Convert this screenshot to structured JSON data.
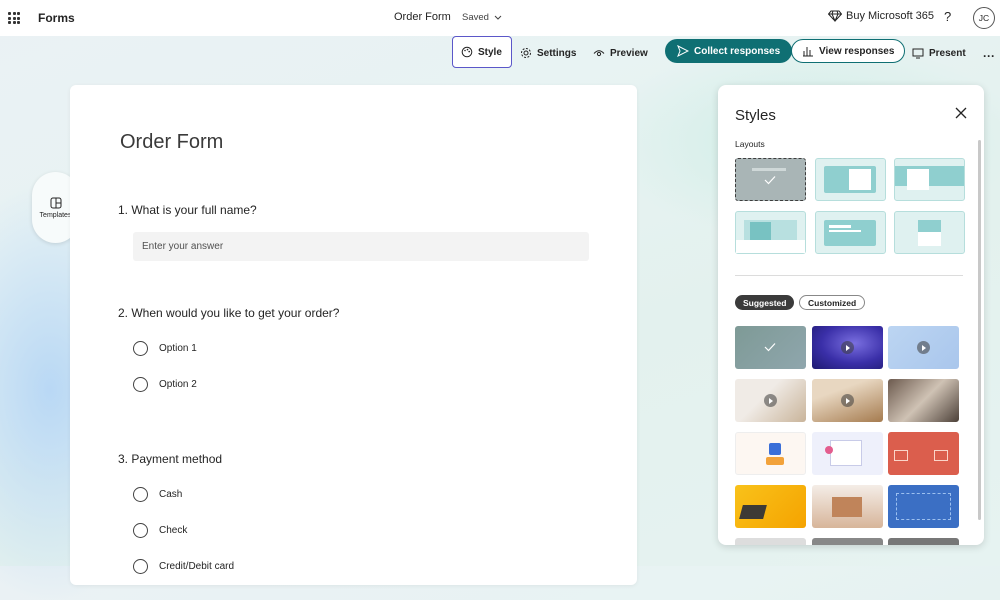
{
  "topbar": {
    "app_name": "Forms",
    "doc_title": "Order Form",
    "save_status": "Saved",
    "buy_label": "Buy Microsoft 365",
    "help": "?",
    "avatar": "JC"
  },
  "toolbar": {
    "style": "Style",
    "settings": "Settings",
    "preview": "Preview",
    "collect": "Collect responses",
    "view": "View responses",
    "present": "Present",
    "more": "···"
  },
  "side": {
    "templates": "Templates"
  },
  "form": {
    "title": "Order Form",
    "questions": [
      {
        "label": "1. What is your full name?",
        "placeholder": "Enter your answer"
      },
      {
        "label": "2. When would you like to get your order?",
        "options": [
          "Option 1",
          "Option 2"
        ]
      },
      {
        "label": "3. Payment method",
        "options": [
          "Cash",
          "Check",
          "Credit/Debit card"
        ]
      }
    ]
  },
  "styles": {
    "title": "Styles",
    "layouts_label": "Layouts",
    "tabs": [
      "Suggested",
      "Customized"
    ]
  },
  "colors": {
    "accent": "#0f6f73",
    "focus": "#5b57c9"
  }
}
